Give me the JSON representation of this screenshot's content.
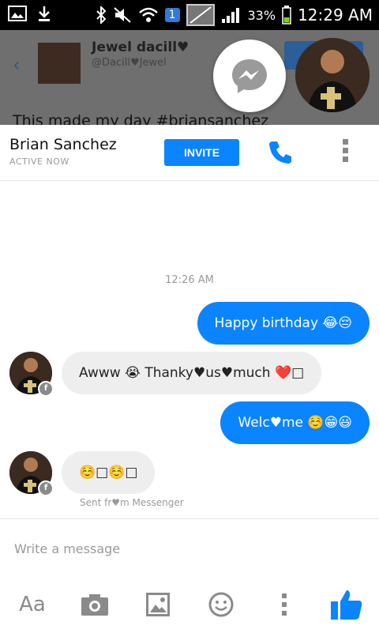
{
  "status_bar": {
    "notification_badge": "1",
    "battery_percent": "33%",
    "time": "12:29 AM"
  },
  "background": {
    "profile_name": "Jewel dacill♥",
    "profile_handle": "@Dacill♥Jewel",
    "tweet_text": "This made my day #briansanchez"
  },
  "chat_head": {
    "messenger_icon": "messenger-icon"
  },
  "header": {
    "contact_name": "Brian Sanchez",
    "status": "ACTIVE NOW",
    "invite_label": "INVITE"
  },
  "conversation": {
    "timestamp": "12:26 AM",
    "messages": [
      {
        "direction": "outgoing",
        "text": "Happy birthday 😂😔"
      },
      {
        "direction": "incoming",
        "text": "Awww 😭 Thanky♥us♥much ❤️□"
      },
      {
        "direction": "outgoing",
        "text": "Welc♥me ☺️😁😃"
      },
      {
        "direction": "incoming",
        "text": "☺️□☺️□"
      }
    ],
    "sent_from": "Sent fr♥m Messenger"
  },
  "composer": {
    "placeholder": "Write a message",
    "text_format_label": "Aa"
  },
  "colors": {
    "accent": "#0a84ff",
    "bubble_incoming": "#eeeeee"
  }
}
